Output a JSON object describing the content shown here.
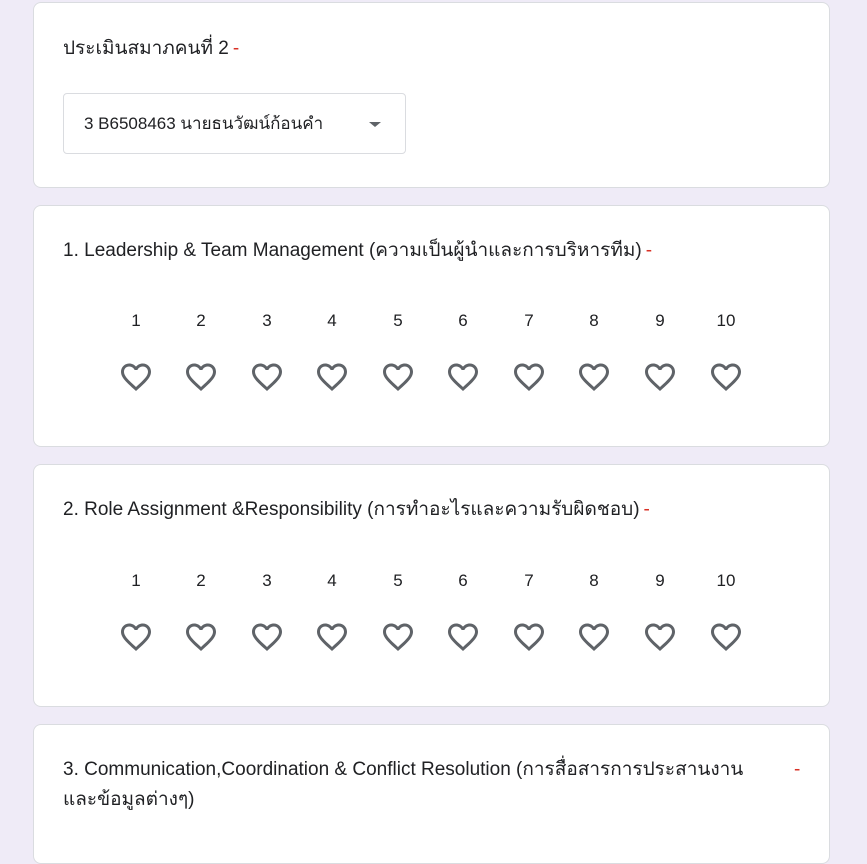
{
  "member_question": {
    "title": "ประเมินสมาภคนที่ 2",
    "required_mark": "-",
    "dropdown_value": "3 B6508463 นายธนวัฒน์ก้อนคำ"
  },
  "questions": [
    {
      "title": "1. Leadership & Team Management (ความเป็นผู้นำและการบริหารทีม)",
      "required_mark": "-",
      "scale": [
        "1",
        "2",
        "3",
        "4",
        "5",
        "6",
        "7",
        "8",
        "9",
        "10"
      ]
    },
    {
      "title": "2. Role Assignment &Responsibility (การทำอะไรและความรับผิดชอบ)",
      "required_mark": "-",
      "scale": [
        "1",
        "2",
        "3",
        "4",
        "5",
        "6",
        "7",
        "8",
        "9",
        "10"
      ]
    },
    {
      "title": "3. Communication,Coordination & Conflict Resolution (การสื่อสารการประสานงาน และข้อมูลต่างๆ)",
      "required_mark": "-"
    }
  ],
  "icons": {
    "rating": "heart-outline-icon",
    "dropdown": "dropdown-arrow-icon"
  },
  "colors": {
    "background": "#efebf7",
    "card": "#ffffff",
    "required": "#d93025",
    "icon": "#5f6368"
  }
}
